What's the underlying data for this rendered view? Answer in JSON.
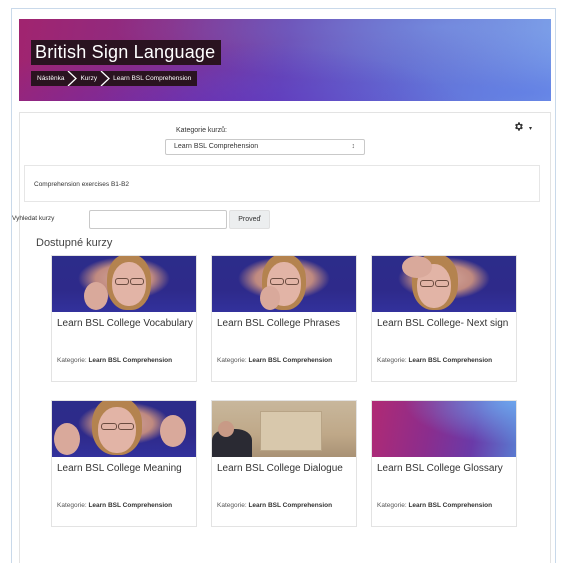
{
  "header": {
    "title": "British Sign Language",
    "breadcrumbs": [
      "Nástěnka",
      "Kurzy",
      "Learn BSL Comprehension"
    ]
  },
  "category": {
    "label": "Kategorie kurzů:",
    "selected": "Learn BSL Comprehension"
  },
  "summary": "Comprehension exercises B1-B2",
  "search": {
    "label": "Vyhledat kurzy",
    "value": "",
    "button": "Proveď"
  },
  "courses_title": "Dostupné kurzy",
  "courses": [
    {
      "name": "Learn BSL College Vocabulary",
      "category_label": "Kategorie:",
      "category": "Learn BSL Comprehension"
    },
    {
      "name": "Learn BSL College Phrases",
      "category_label": "Kategorie:",
      "category": "Learn BSL Comprehension"
    },
    {
      "name": "Learn BSL College- Next sign",
      "category_label": "Kategorie:",
      "category": "Learn BSL Comprehension"
    },
    {
      "name": "Learn BSL College Meaning",
      "category_label": "Kategorie:",
      "category": "Learn BSL Comprehension"
    },
    {
      "name": "Learn BSL College Dialogue",
      "category_label": "Kategorie:",
      "category": "Learn BSL Comprehension"
    },
    {
      "name": "Learn BSL College Glossary",
      "category_label": "Kategorie:",
      "category": "Learn BSL Comprehension"
    }
  ],
  "icons": {
    "settings": "gear-icon",
    "settings_menu": "caret-down-icon",
    "select": "select-arrows-icon"
  },
  "colors": {
    "banner_start": "#a1246f",
    "banner_end": "#7ea1e6",
    "title_bg": "#2a1320"
  }
}
